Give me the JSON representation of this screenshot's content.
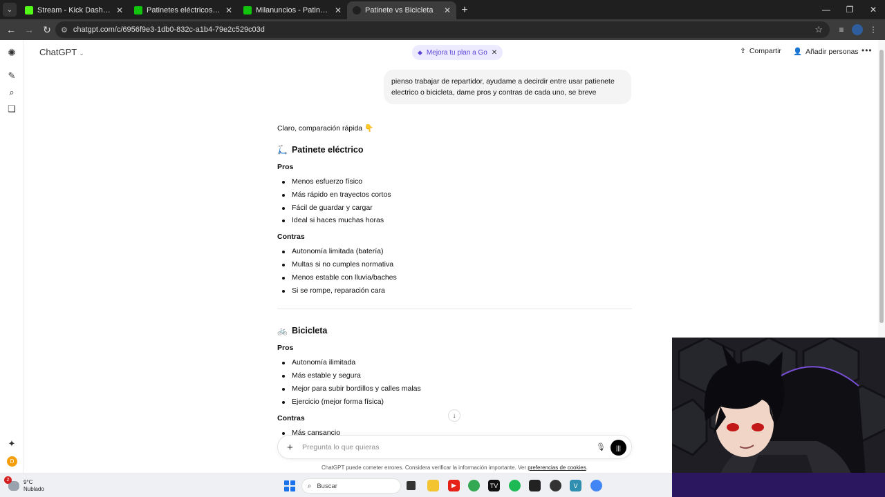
{
  "browser": {
    "tabs": [
      {
        "title": "Stream - Kick Dashboard",
        "color": "#53fc18",
        "active": false
      },
      {
        "title": "Patinetes eléctricos de segunda",
        "color": "#12c40e",
        "active": false
      },
      {
        "title": "Milanuncios - Patinete Eléctrico",
        "color": "#12c40e",
        "active": false
      },
      {
        "title": "Patinete vs Bicicleta",
        "color": "#202020",
        "active": true
      }
    ],
    "url": "chatgpt.com/c/6956f9e3-1db0-832c-a1b4-79e2c529c03d"
  },
  "header": {
    "app_title": "ChatGPT",
    "upgrade_label": "Mejora tu plan a Go",
    "share_label": "Compartir",
    "add_people_label": "Añadir personas"
  },
  "chat": {
    "user_message": "pienso trabajar de repartidor, ayudame a decirdir entre usar patienete electrico o bicicleta, dame pros y contras de cada uno, se breve",
    "intro": "Claro, comparación rápida 👇",
    "sections": [
      {
        "emoji": "🛴",
        "title": "Patinete eléctrico",
        "pros_label": "Pros",
        "pros": [
          "Menos esfuerzo físico",
          "Más rápido en trayectos cortos",
          "Fácil de guardar y cargar",
          "Ideal si haces muchas horas"
        ],
        "cons_label": "Contras",
        "cons": [
          "Autonomía limitada (batería)",
          "Multas si no cumples normativa",
          "Menos estable con lluvia/baches",
          "Si se rompe, reparación cara"
        ]
      },
      {
        "emoji": "🚲",
        "title": "Bicicleta",
        "pros_label": "Pros",
        "pros": [
          "Autonomía ilimitada",
          "Más estable y segura",
          "Mejor para subir bordillos y calles malas",
          "Ejercicio (mejor forma física)"
        ],
        "cons_label": "Contras",
        "cons": [
          "Más cansancio"
        ]
      }
    ]
  },
  "composer": {
    "placeholder": "Pregunta lo que quieras",
    "disclaimer": "ChatGPT puede cometer errores. Considera verificar la información importante. Ver",
    "disclaimer_link": "preferencias de cookies"
  },
  "taskbar": {
    "weather_temp": "9°C",
    "weather_desc": "Nublado",
    "notification_count": "2",
    "search_label": "Buscar"
  }
}
